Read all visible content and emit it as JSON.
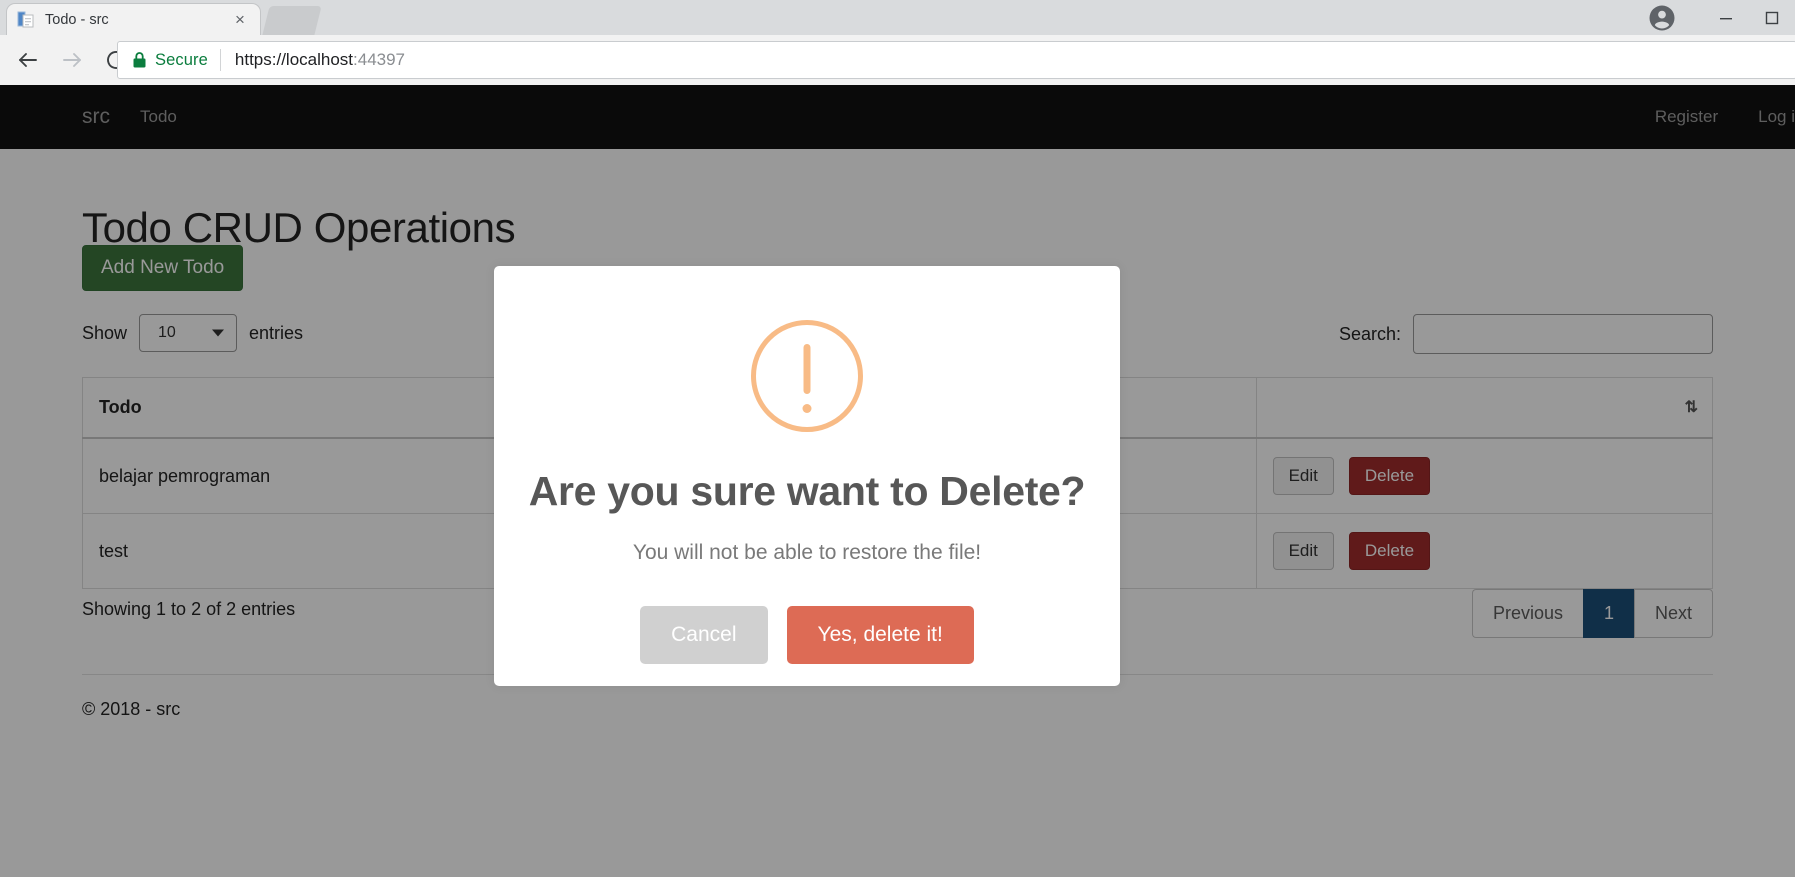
{
  "browser": {
    "tab": {
      "title": "Todo - src",
      "favicon_icon": "page-icon",
      "close_icon": "×"
    },
    "new_tab_icon": "new-tab-ghost",
    "profile_icon": "account-circle-icon",
    "minimize_icon": "─",
    "maximize_icon": "□",
    "back_icon": "←",
    "forward_icon": "→",
    "reload_icon": "↻",
    "omnibox": {
      "lock_icon": "lock-icon",
      "secure_label": "Secure",
      "url_scheme_host": "https://localhost",
      "url_port": ":44397"
    }
  },
  "navbar": {
    "brand": "src",
    "links": [
      {
        "label": "Todo"
      }
    ],
    "right_links": [
      {
        "label": "Register"
      },
      {
        "label": "Log i"
      }
    ]
  },
  "main": {
    "title": "Todo CRUD Operations",
    "add_button": "Add New Todo",
    "datatable": {
      "show_label": "Show",
      "length_value": "10",
      "entries_label": "entries",
      "length_caret_icon": "caret-down-icon",
      "search_label": "Search:",
      "search_value": "",
      "search_placeholder": "",
      "columns": [
        {
          "label": "Todo",
          "sort_icon": "⇅"
        },
        {
          "label": "",
          "sort_icon": "⇅"
        }
      ],
      "rows": [
        {
          "todo": "belajar pemrograman",
          "edit_label": "Edit",
          "delete_label": "Delete"
        },
        {
          "todo": "test",
          "edit_label": "Edit",
          "delete_label": "Delete"
        }
      ],
      "info": "Showing 1 to 2 of 2 entries",
      "pagination": {
        "previous": "Previous",
        "pages": [
          "1"
        ],
        "active_page": "1",
        "next": "Next"
      }
    }
  },
  "footer": {
    "text": "© 2018 - src"
  },
  "modal": {
    "icon": "warning-exclamation-icon",
    "title": "Are you sure want to Delete?",
    "text": "You will not be able to restore the file!",
    "cancel_label": "Cancel",
    "confirm_label": "Yes, delete it!"
  },
  "colors": {
    "navbar_bg": "#111111",
    "add_button_bg": "#3c763d",
    "delete_button_bg": "#a02c2c",
    "pagination_active_bg": "#1b4f79",
    "modal_warning": "#f8bb86",
    "modal_confirm_bg": "#dd6b55",
    "modal_cancel_bg": "#d0d0d0",
    "secure_green": "#0b7d3e"
  }
}
